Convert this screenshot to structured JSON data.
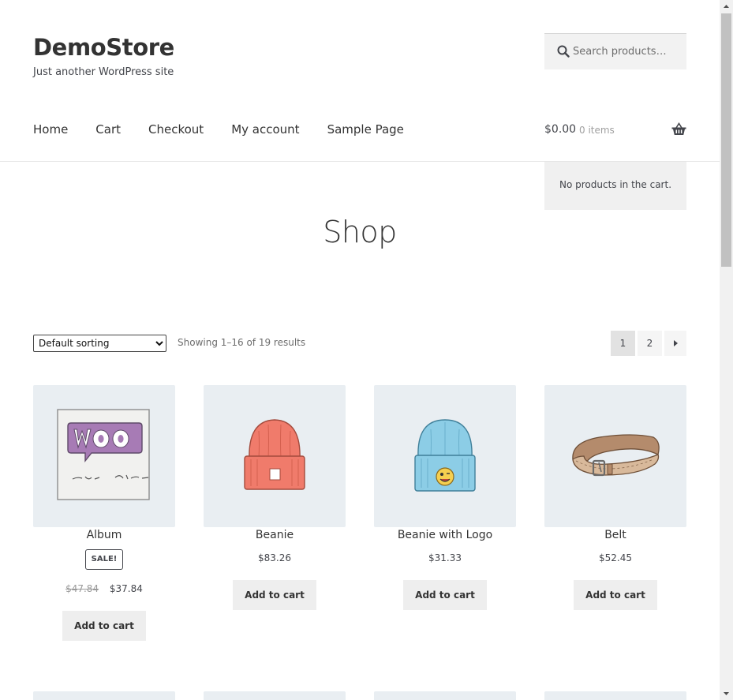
{
  "site": {
    "title": "DemoStore",
    "tagline": "Just another WordPress site"
  },
  "search": {
    "placeholder": "Search products…"
  },
  "nav": {
    "items": [
      {
        "label": "Home"
      },
      {
        "label": "Cart"
      },
      {
        "label": "Checkout"
      },
      {
        "label": "My account"
      },
      {
        "label": "Sample Page"
      }
    ]
  },
  "cart": {
    "total": "$0.00",
    "count": "0 items",
    "empty_message": "No products in the cart."
  },
  "page": {
    "title": "Shop"
  },
  "toolbar": {
    "sort_selected": "Default sorting",
    "result_count": "Showing 1–16 of 19 results"
  },
  "pagination": {
    "pages": [
      "1",
      "2"
    ],
    "current": "1",
    "next_icon": "triangle-right-icon"
  },
  "products": [
    {
      "name": "Album",
      "sale_badge": "SALE!",
      "regular_price": "$47.84",
      "sale_price": "$37.84",
      "button": "Add to cart"
    },
    {
      "name": "Beanie",
      "price": "$83.26",
      "button": "Add to cart"
    },
    {
      "name": "Beanie with Logo",
      "price": "$31.33",
      "button": "Add to cart"
    },
    {
      "name": "Belt",
      "price": "$52.45",
      "button": "Add to cart"
    }
  ],
  "colors": {
    "text": "#43454b",
    "heading": "#333333",
    "product_bg": "#e9eef2",
    "button_bg": "#eeeeee",
    "beanie": "#f07b6b",
    "beanie_logo": "#8ccde6",
    "belt": "#c9a68a",
    "woo_purple": "#a77bb5"
  },
  "icons": {
    "search": "search-icon",
    "basket": "basket-icon"
  }
}
